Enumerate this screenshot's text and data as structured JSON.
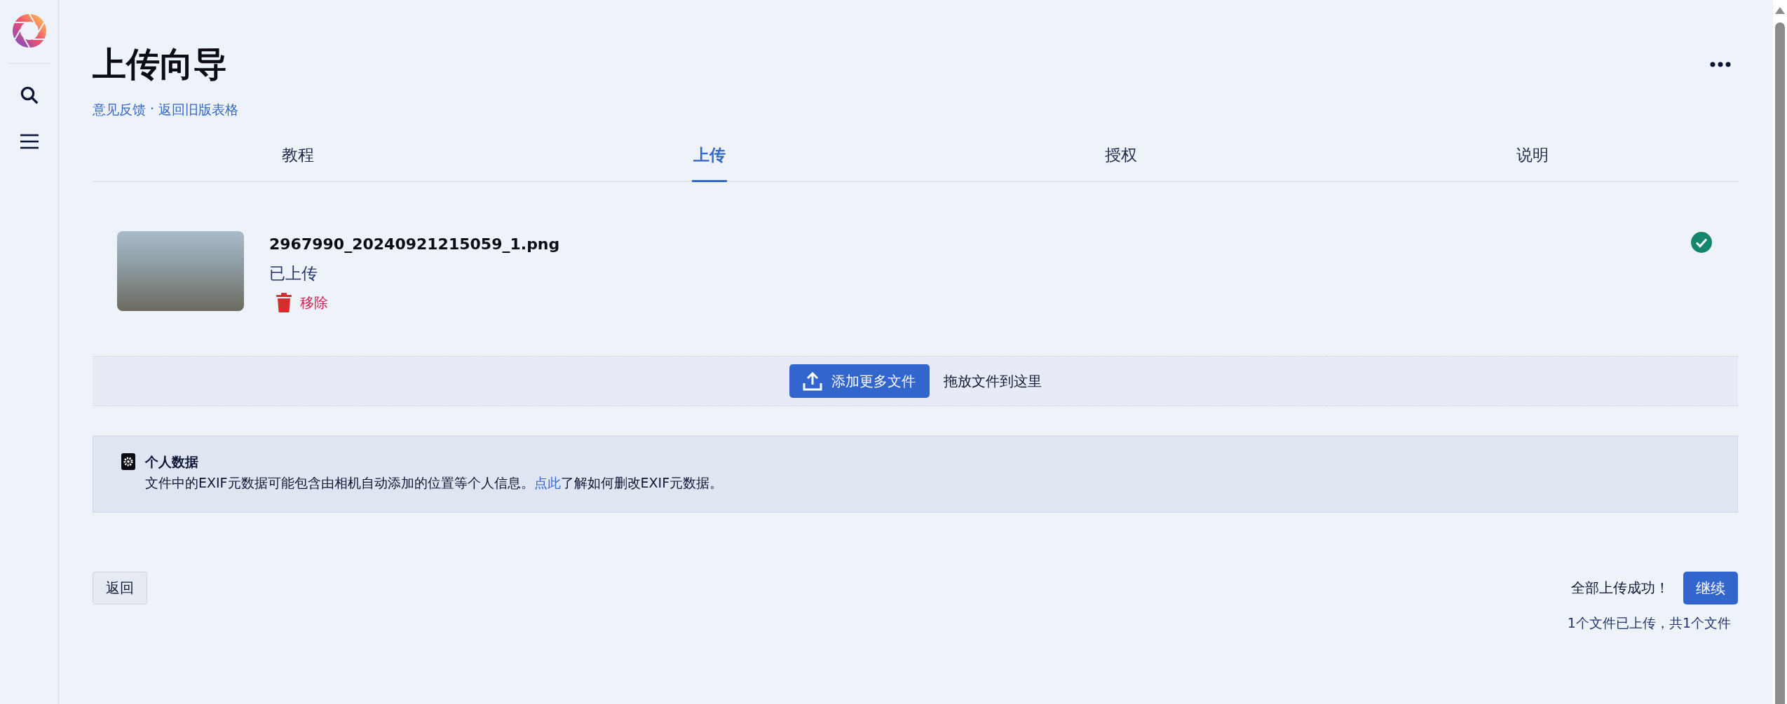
{
  "page": {
    "title": "上传向导",
    "links": [
      "意见反馈",
      "返回旧版表格"
    ],
    "link_separator": "·"
  },
  "tabs": [
    {
      "label": "教程",
      "selected": false
    },
    {
      "label": "上传",
      "selected": true
    },
    {
      "label": "授权",
      "selected": false
    },
    {
      "label": "说明",
      "selected": false
    }
  ],
  "files": [
    {
      "name": "2967990_20240921215059_1.png",
      "status": "已上传",
      "remove": "移除"
    }
  ],
  "dropzone": {
    "button": "添加更多文件",
    "hint": "拖放文件到这里"
  },
  "notice": {
    "title": "个人数据",
    "text_before": "文件中的EXIF元数据可能包含由相机自动添加的位置等个人信息。",
    "link": "点此",
    "text_after": "了解如何删改EXIF元数据。"
  },
  "footer": {
    "back": "返回",
    "message": "全部上传成功！",
    "continue": "继续",
    "count": "1个文件已上传，共1个文件"
  }
}
